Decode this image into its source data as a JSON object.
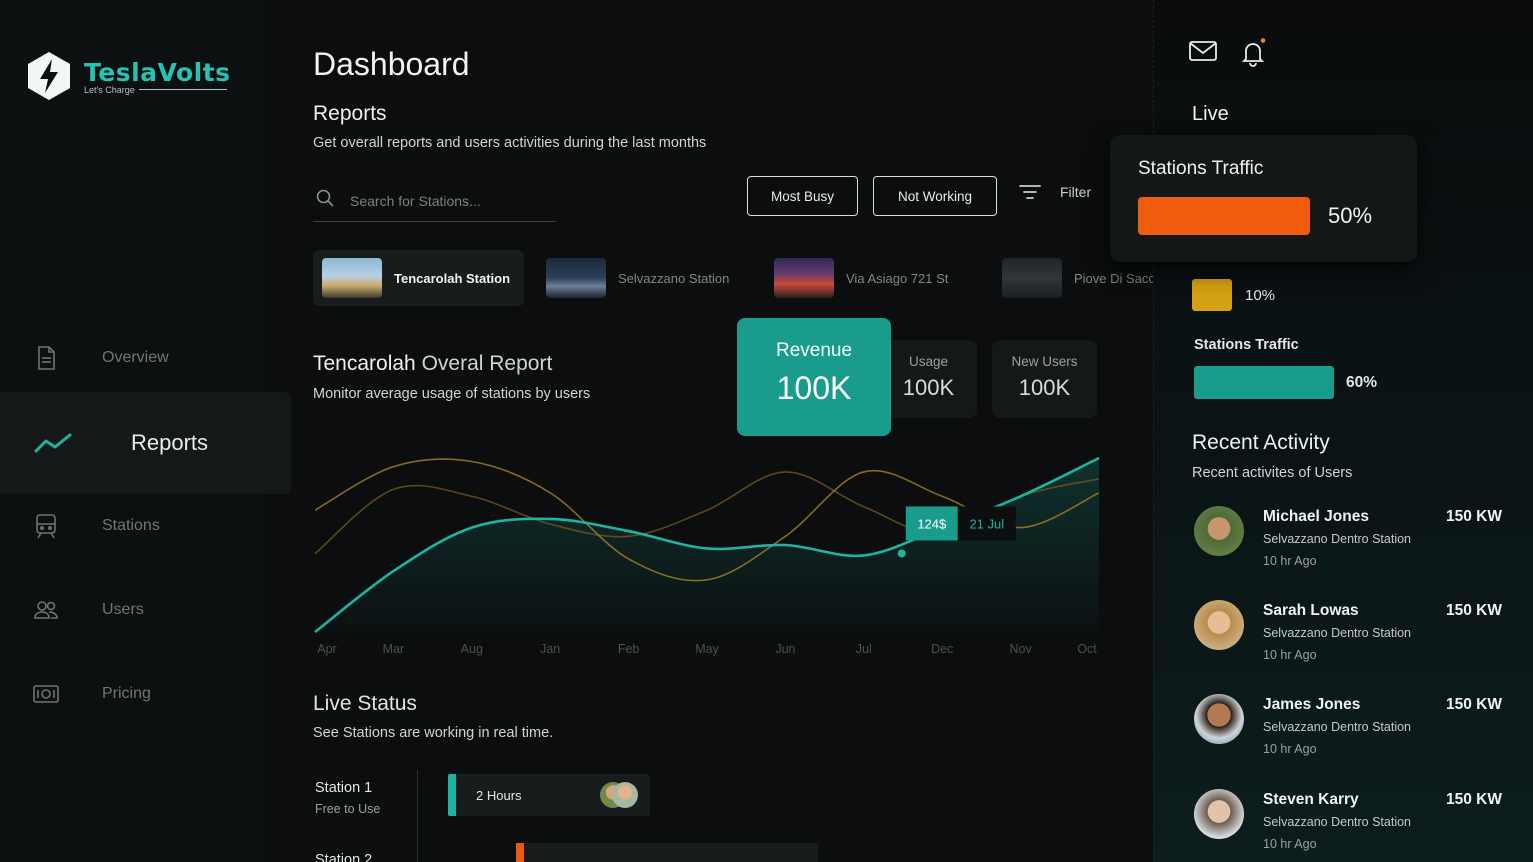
{
  "brand": {
    "name": "TeslaVolts",
    "tagline": "Let's Charge",
    "accent": "#27c2b1"
  },
  "nav": {
    "items": [
      {
        "label": "Overview",
        "icon": "document-icon"
      },
      {
        "label": "Reports",
        "icon": "trend-icon",
        "active": true
      },
      {
        "label": "Stations",
        "icon": "train-icon"
      },
      {
        "label": "Users",
        "icon": "users-icon"
      },
      {
        "label": "Pricing",
        "icon": "money-icon"
      }
    ]
  },
  "header": {
    "title": "Dashboard"
  },
  "reports": {
    "title": "Reports",
    "subtitle": "Get overall reports and users activities during the last months",
    "search_placeholder": "Search for Stations...",
    "btn_most_busy": "Most Busy",
    "btn_not_working": "Not Working",
    "filter_label": "Filter"
  },
  "stations": [
    {
      "name": "Tencarolah Station",
      "active": true
    },
    {
      "name": "Selvazzano Station"
    },
    {
      "name": "Via Asiago 721 St"
    },
    {
      "name": "Piove Di Sacco"
    }
  ],
  "overall": {
    "title_bold": "Tencarolah",
    "title_light": " Overal Report",
    "subtitle": "Monitor average usage of stations by users",
    "kpis": [
      {
        "label": "Revenue",
        "value": "100K",
        "primary": true
      },
      {
        "label": "Usage",
        "value": "100K"
      },
      {
        "label": "New Users",
        "value": "100K"
      }
    ]
  },
  "chart_data": {
    "type": "line",
    "categories": [
      "Apr",
      "Mar",
      "Aug",
      "Jan",
      "Feb",
      "May",
      "Jun",
      "Jul",
      "Dec",
      "Nov",
      "Oct"
    ],
    "series": [
      {
        "values": [
          0,
          35,
          60,
          65,
          58,
          48,
          50,
          44,
          60,
          78,
          100
        ],
        "color": "#1fb3a1"
      },
      {
        "values": [
          70,
          95,
          98,
          80,
          42,
          30,
          55,
          92,
          78,
          60,
          80
        ],
        "color": "#b0892a"
      },
      {
        "values": [
          45,
          82,
          78,
          62,
          55,
          70,
          92,
          72,
          56,
          78,
          88
        ],
        "color": "#7a5a22"
      }
    ],
    "tooltip": {
      "value": "124$",
      "date": "21 Jul"
    },
    "ylim": [
      0,
      100
    ]
  },
  "live_status": {
    "title": "Live Status",
    "subtitle": "See Stations are working in real time.",
    "rows": [
      {
        "name": "Station 1",
        "sub": "Free to Use",
        "bar": "2 Hours"
      },
      {
        "name": "Station 2"
      }
    ]
  },
  "right": {
    "live_label": "Live",
    "popup": {
      "title": "Stations Traffic",
      "value": "50%",
      "fraction": 0.5,
      "color": "#ef5c0e"
    },
    "not_working": {
      "value": "10%",
      "color": "#d4a015"
    },
    "traffic": {
      "label": "Stations Traffic",
      "value": "60%",
      "color": "#1a9c8d"
    },
    "recent": {
      "title": "Recent Activity",
      "subtitle": "Recent activites of Users",
      "items": [
        {
          "name": "Michael Jones",
          "station": "Selvazzano Dentro Station",
          "ago": "10 hr Ago",
          "kw": "150 KW"
        },
        {
          "name": "Sarah Lowas",
          "station": "Selvazzano Dentro Station",
          "ago": "10 hr Ago",
          "kw": "150 KW"
        },
        {
          "name": "James Jones",
          "station": "Selvazzano Dentro Station",
          "ago": "10 hr Ago",
          "kw": "150 KW"
        },
        {
          "name": "Steven Karry",
          "station": "Selvazzano Dentro Station",
          "ago": "10 hr Ago",
          "kw": "150 KW"
        }
      ]
    }
  }
}
